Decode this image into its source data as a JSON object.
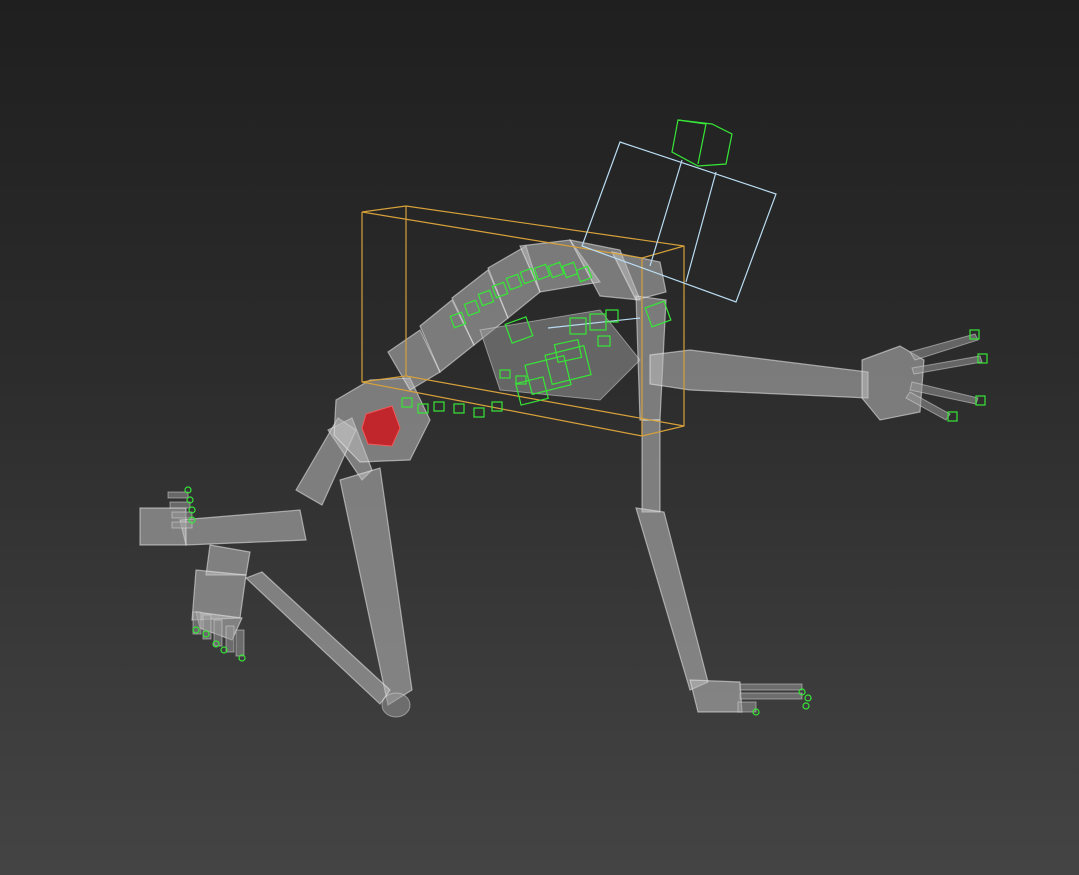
{
  "viewport": {
    "background_top": "#1f1f1f",
    "background_bottom": "#444444"
  },
  "colors": {
    "bone_fill": "#bebebe",
    "control_green": "#37e637",
    "selection_box": "#d6a13a",
    "camera_frame": "#b9dcf2",
    "root_control": "#c0262b"
  }
}
